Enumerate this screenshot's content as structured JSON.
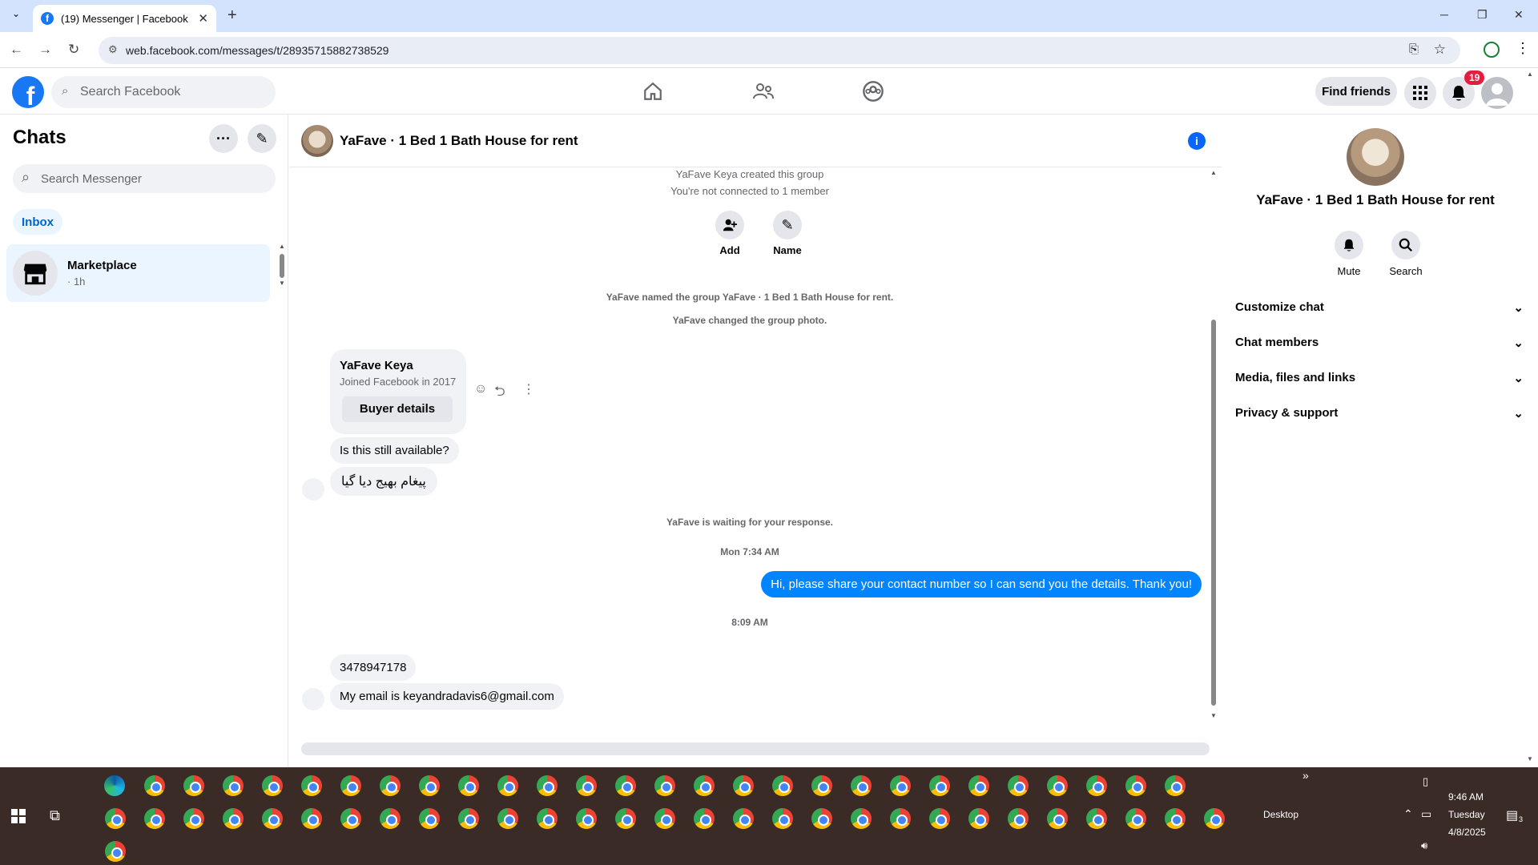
{
  "browser": {
    "tab_title": "(19) Messenger | Facebook",
    "url": "web.facebook.com/messages/t/28935715882738529"
  },
  "fb_header": {
    "search_placeholder": "Search Facebook",
    "find_friends": "Find friends",
    "notification_count": "19"
  },
  "left_panel": {
    "title": "Chats",
    "search_placeholder": "Search Messenger",
    "filter_tab": "Inbox",
    "chat_items": [
      {
        "name": "Marketplace",
        "time": "· 1h"
      }
    ]
  },
  "conversation": {
    "title": "YaFave · 1 Bed 1 Bath House for rent",
    "created_text": "YaFave Keya created this group",
    "connected_text": "You're not connected to 1 member",
    "add_label": "Add",
    "name_label": "Name",
    "named_text": "YaFave named the group YaFave · 1 Bed 1 Bath House for rent.",
    "photo_text": "YaFave changed the group photo.",
    "buyer_card": {
      "name": "YaFave Keya",
      "joined": "Joined Facebook in 2017",
      "button": "Buyer details"
    },
    "msg_available": "Is this still available?",
    "msg_urdu": "پیغام بھیج دیا گیا",
    "waiting_text": "YaFave is waiting for your response.",
    "time_1": "Mon 7:34 AM",
    "msg_sent": "Hi, please share your contact number so I can send you the details. Thank you!",
    "time_2": "8:09 AM",
    "msg_phone": "3478947178",
    "msg_email": "My email is keyandradavis6@gmail.com"
  },
  "right_panel": {
    "title": "YaFave · 1 Bed 1 Bath House for rent",
    "mute": "Mute",
    "search": "Search",
    "sections": [
      "Customize chat",
      "Chat members",
      "Media, files and links",
      "Privacy & support"
    ]
  },
  "taskbar": {
    "desktop_label": "Desktop",
    "time": "9:46 AM",
    "day": "Tuesday",
    "date": "4/8/2025",
    "notif_count": "3"
  },
  "colors": {
    "fb_blue": "#1877f2",
    "sent_bubble": "#0084ff",
    "taskbar": "#3a2b26"
  }
}
